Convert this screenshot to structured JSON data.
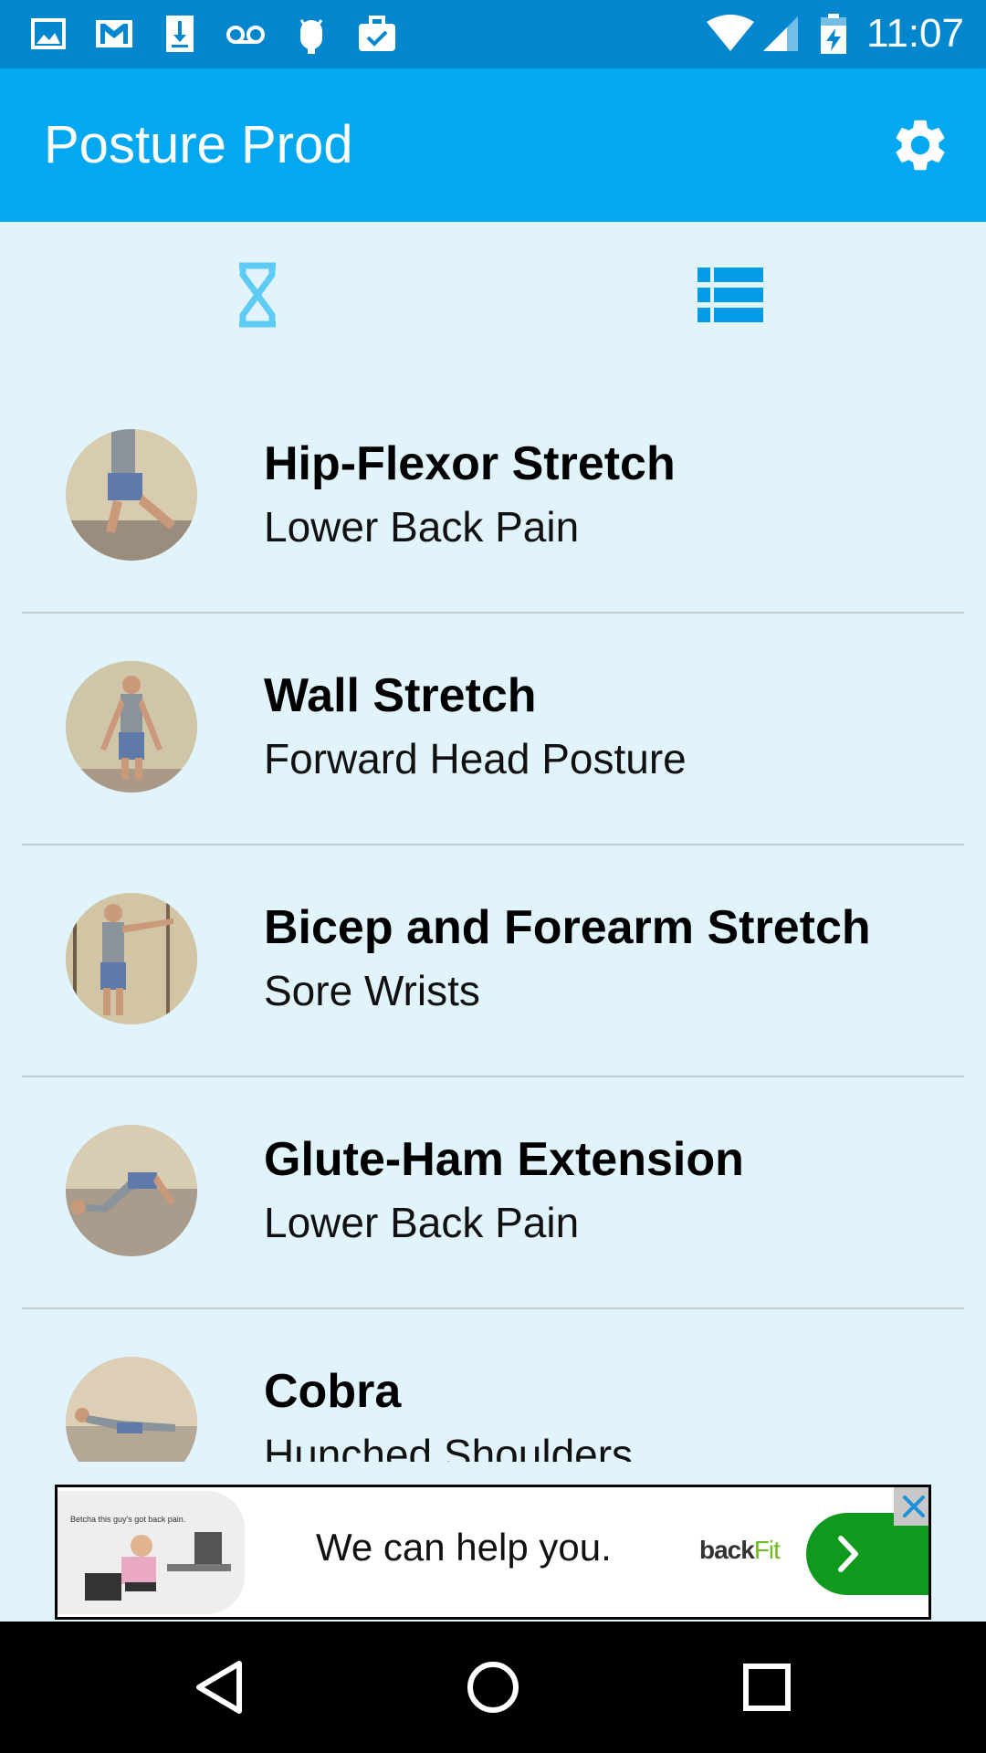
{
  "status_bar": {
    "time": "11:07",
    "left_icons": [
      "image-icon",
      "gmail-icon",
      "download-icon",
      "voicemail-icon",
      "android-icon",
      "briefcase-icon"
    ],
    "right_icons": [
      "wifi-icon",
      "signal-icon",
      "battery-charging-icon"
    ]
  },
  "app_bar": {
    "title": "Posture Prod",
    "settings_icon": "gear-icon",
    "color": "#03a8f1"
  },
  "tabs": [
    {
      "icon": "hourglass-icon",
      "selected": false
    },
    {
      "icon": "list-icon",
      "selected": true
    }
  ],
  "exercises": [
    {
      "title": "Hip-Flexor Stretch",
      "subtitle": "Lower Back Pain"
    },
    {
      "title": "Wall Stretch",
      "subtitle": "Forward Head Posture"
    },
    {
      "title": "Bicep and Forearm Stretch",
      "subtitle": "Sore Wrists"
    },
    {
      "title": "Glute-Ham Extension",
      "subtitle": "Lower Back Pain"
    },
    {
      "title": "Cobra",
      "subtitle": "Hunched Shoulders"
    }
  ],
  "ad": {
    "caption": "Betcha this guy's got back pain.",
    "text": "We can help you.",
    "brand_main": "back",
    "brand_accent": "Fit",
    "cta_icon": "chevron-right-icon",
    "close_icon": "close-icon",
    "accent": "#0f9a1d"
  },
  "nav_bar": {
    "icons": [
      "back-icon",
      "home-icon",
      "recents-icon"
    ]
  }
}
